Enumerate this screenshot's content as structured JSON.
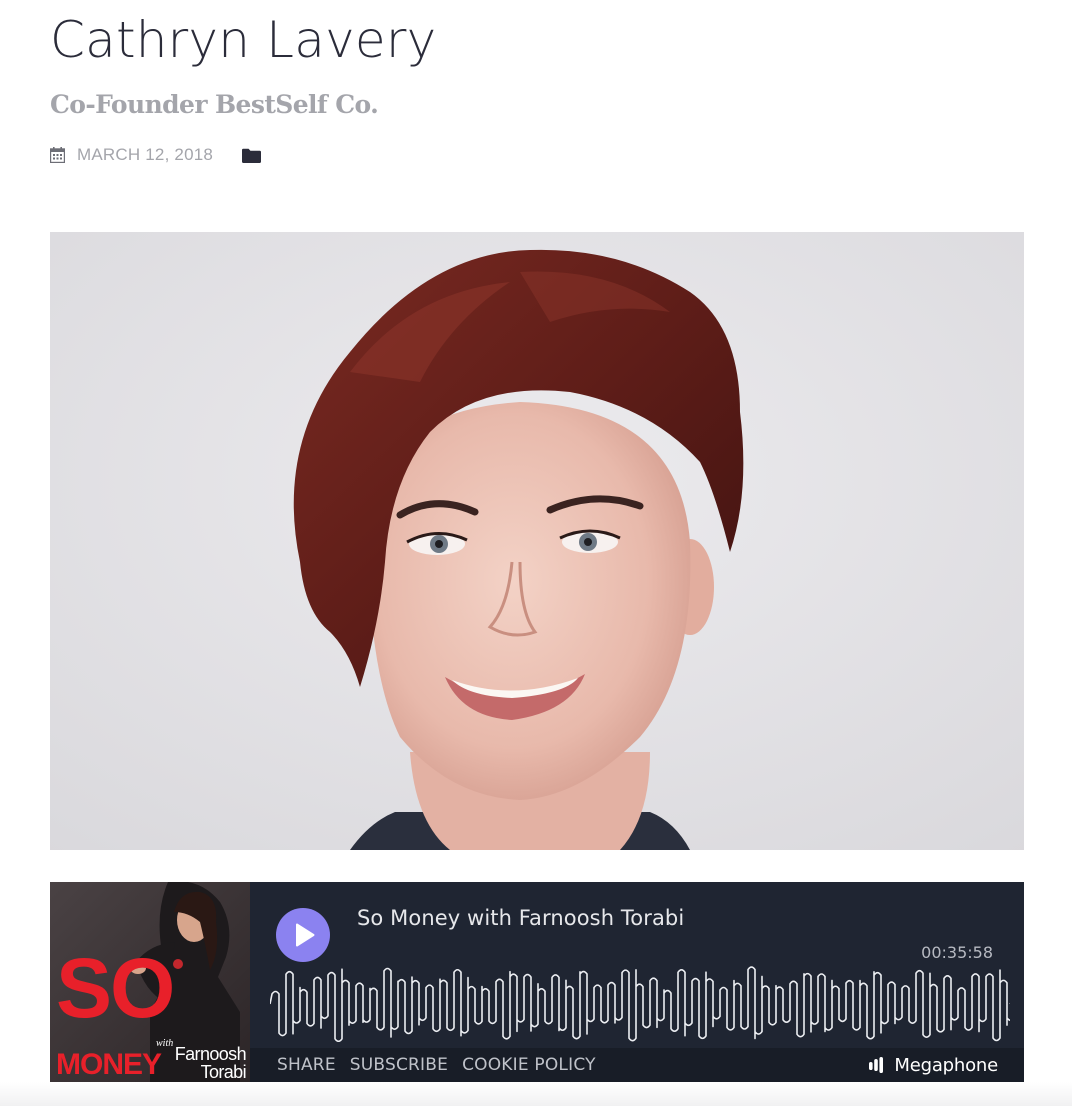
{
  "post": {
    "title": "Cathryn Lavery",
    "subtitle": "Co-Founder BestSelf Co.",
    "date": "MARCH 12, 2018"
  },
  "icons": {
    "date": "calendar-icon",
    "category": "folder-icon",
    "play": "play-icon",
    "brand": "megaphone-logo-icon"
  },
  "colors": {
    "title": "#2b2c3a",
    "meta": "#a4a5ab",
    "player_background": "#1f2532",
    "play_button": "#8b82f0",
    "cover_red": "#e8202a"
  },
  "player": {
    "cover": {
      "line1": "SO",
      "line2": "MONEY",
      "with": "with",
      "host_first": "Farnoosh",
      "host_last": "Torabi"
    },
    "episode_title": "So Money with Farnoosh Torabi",
    "duration": "00:35:58",
    "progress": 0,
    "footer_links": [
      "SHARE",
      "SUBSCRIBE",
      "COOKIE  POLICY"
    ],
    "brand": "Megaphone"
  }
}
